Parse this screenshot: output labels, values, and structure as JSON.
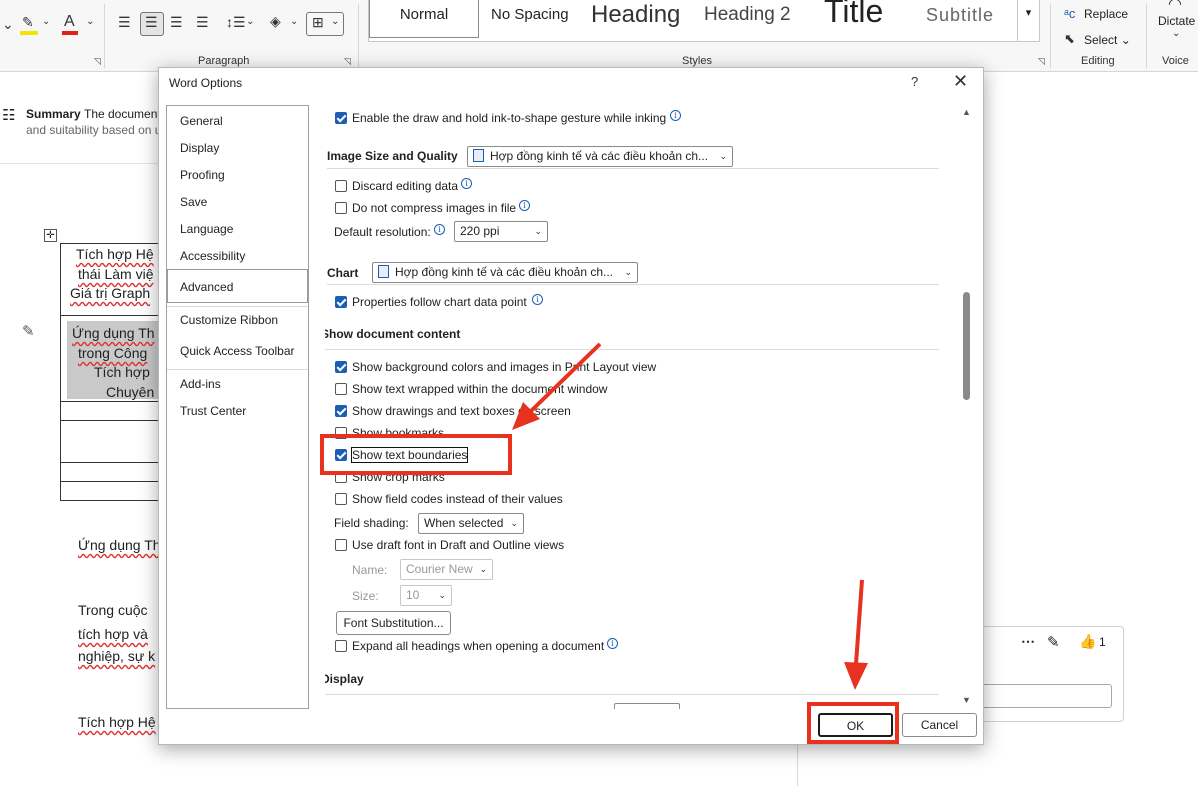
{
  "ribbon": {
    "paragraph_label": "Paragraph",
    "styles_label": "Styles",
    "editing_label": "Editing",
    "voice_label": "Voice",
    "styles": [
      "Normal",
      "No Spacing",
      "Heading",
      "Heading 2",
      "Title",
      "Subtitle"
    ],
    "replace_label": "Replace",
    "select_label": "Select",
    "dictate_label": "Dictate"
  },
  "document": {
    "summary_title": "Summary",
    "summary_text": "The document",
    "summary_text2": "and suitability based on u",
    "lines": [
      "Tích hợp Hệ",
      "thái Làm việ",
      "Giá trị Graph",
      "Ứng dụng Th",
      "trong Công ",
      "Tích hợp ",
      "Chuyên",
      "Ứng dụng Th",
      "Trong cuộc ",
      "tích hợp và ",
      "nghiệp, sự k",
      "Tích hợp Hệ"
    ],
    "comment_likes": "1"
  },
  "dialog": {
    "title": "Word Options",
    "help": "?",
    "close": "✕",
    "nav": [
      "General",
      "Display",
      "Proofing",
      "Save",
      "Language",
      "Accessibility",
      "Advanced",
      "Customize Ribbon",
      "Quick Access Toolbar",
      "Add-ins",
      "Trust Center"
    ],
    "ink_option": "Enable the draw and hold ink-to-shape gesture while inking",
    "image_size_label": "Image Size and Quality",
    "image_doc": "Hợp đồng kinh tế và các điều khoản ch...",
    "discard_label": "Discard editing data",
    "compress_label": "Do not compress images in file",
    "resolution_label": "Default resolution:",
    "resolution_value": "220 ppi",
    "chart_label": "Chart",
    "chart_doc": "Hợp đồng kinh tế và các điều khoản ch...",
    "chart_props_label": "Properties follow chart data point",
    "show_content_label": "Show document content",
    "opt_bg_colors": "Show background colors and images in Print Layout view",
    "opt_wrapped": "Show text wrapped within the document window",
    "opt_drawings": "Show drawings and text boxes on screen",
    "opt_bookmarks": "Show bookmarks",
    "opt_boundaries": "Show text boundaries",
    "opt_crop": "Show crop marks",
    "opt_field_codes": "Show field codes instead of their values",
    "field_shading_label": "Field shading:",
    "field_shading_value": "When selected",
    "opt_draft_font": "Use draft font in Draft and Outline views",
    "name_label": "Name:",
    "name_value": "Courier New",
    "size_label": "Size:",
    "size_value": "10",
    "font_sub_button": "Font Substitution...",
    "opt_expand_headings": "Expand all headings when opening a document",
    "display_label": "Display",
    "ok_button": "OK",
    "cancel_button": "Cancel"
  }
}
